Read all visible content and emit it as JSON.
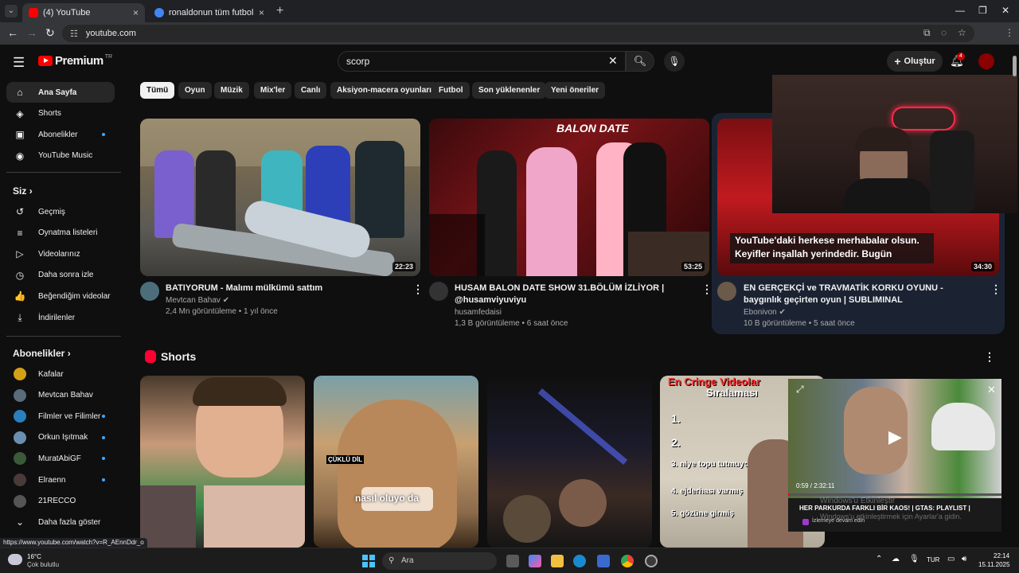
{
  "browser": {
    "tabs": [
      {
        "title": "(4) YouTube",
        "active": true,
        "favicon_color": "#ff0000"
      },
      {
        "title": "ronaldonun tüm futbol geçmişi",
        "active": false,
        "favicon_color": "#4285f4"
      }
    ],
    "url": "youtube.com",
    "new_tab": "+",
    "close": "×"
  },
  "header": {
    "logo_text": "Premium",
    "logo_region": "TR",
    "search_value": "scorp",
    "create_label": "Oluştur",
    "notifications": "4"
  },
  "sidebar": {
    "main": [
      {
        "label": "Ana Sayfa",
        "icon": "home-icon",
        "glyph": "⌂"
      },
      {
        "label": "Shorts",
        "icon": "shorts-icon",
        "glyph": "◈"
      },
      {
        "label": "Abonelikler",
        "icon": "subscriptions-icon",
        "glyph": "▣"
      },
      {
        "label": "YouTube Music",
        "icon": "music-icon",
        "glyph": "◉"
      }
    ],
    "you_heading": "Siz",
    "you": [
      {
        "label": "Geçmiş",
        "icon": "history-icon",
        "glyph": "↺"
      },
      {
        "label": "Oynatma listeleri",
        "icon": "playlists-icon",
        "glyph": "≡"
      },
      {
        "label": "Videolarınız",
        "icon": "your-videos-icon",
        "glyph": "▷"
      },
      {
        "label": "Daha sonra izle",
        "icon": "watch-later-icon",
        "glyph": "◷"
      },
      {
        "label": "Beğendiğim videolar",
        "icon": "liked-icon",
        "glyph": "👍"
      },
      {
        "label": "İndirilenler",
        "icon": "downloads-icon",
        "glyph": "⤓"
      }
    ],
    "subs_heading": "Abonelikler",
    "subs": [
      {
        "label": "Kafalar",
        "color": "#d4a017"
      },
      {
        "label": "Mevtcan Bahav",
        "color": "#5a6b7a"
      },
      {
        "label": "Filmler ve Filimler",
        "color": "#2a7fbf"
      },
      {
        "label": "Orkun Işıtmak",
        "color": "#6a8fb0"
      },
      {
        "label": "MuratAbiGF",
        "color": "#3a5a3a"
      },
      {
        "label": "Elraenn",
        "color": "#4a3a3a"
      },
      {
        "label": "21RECCO",
        "color": "#555"
      }
    ],
    "show_more": "Daha fazla göster"
  },
  "chips": [
    "Tümü",
    "Oyun",
    "Müzik",
    "Mix'ler",
    "Canlı",
    "Aksiyon-macera oyunları",
    "Futbol",
    "Son yüklenenler",
    "Yeni öneriler"
  ],
  "videos": [
    {
      "title": "BATIYORUM - Malımı mülkümü sattım",
      "channel": "Mevtcan Bahav",
      "meta": "2,4 Mn görüntüleme • 1 yıl önce",
      "duration": "22:23"
    },
    {
      "title": "HUSAM BALON DATE SHOW 31.BÖLÜM İZLİYOR | @husamviyuviyu",
      "channel": "husamfedaisi",
      "meta": "1,3 B görüntüleme • 6 saat önce",
      "duration": "53:25"
    },
    {
      "title": "EN GERÇEKÇİ ve TRAVMATİK KORKU OYUNU - baygınlık geçirten oyun | SUBLIMINAL",
      "channel": "Ebonivon",
      "meta": "10 B görüntüleme • 5 saat önce",
      "duration": "34:30"
    }
  ],
  "thumb_texts": {
    "v2_logo": "BALON DATE",
    "v3_caption_1": "YouTube'daki herkese merhabalar olsun.",
    "v3_caption_2": "Keyifler inşallah yerindedir. Bugün"
  },
  "shorts": {
    "title": "Shorts",
    "s2_caption": "nasıl oluyo da",
    "s2_tag": "ÇÜKLÜ DİL",
    "s4_heading_1": "En Cringe Videolar",
    "s4_heading_2": "Sıralaması",
    "s4_items": [
      "1.",
      "2.",
      "3. niye topu tutmuyorsun",
      "4. ejderhası varmış",
      "5. gözüne girmiş"
    ]
  },
  "miniplayer": {
    "time": "0:59 / 2:32:11",
    "title": "HER PARKURDA FARKLI BİR KAOS! | GTAS: PLAYLIST |",
    "action": "İzlemeye devam edin",
    "watermark_1": "Windows'u Etkinleştir",
    "watermark_2": "Windows'u etkinleştirmek için Ayarlar'a gidin."
  },
  "status_url": "https://www.youtube.com/watch?v=R_AEnnDdr_o",
  "taskbar": {
    "temp": "16°C",
    "weather": "Çok bulutlu",
    "search": "Ara",
    "lang": "TUR",
    "time": "22:14",
    "date": "15.11.2025"
  }
}
